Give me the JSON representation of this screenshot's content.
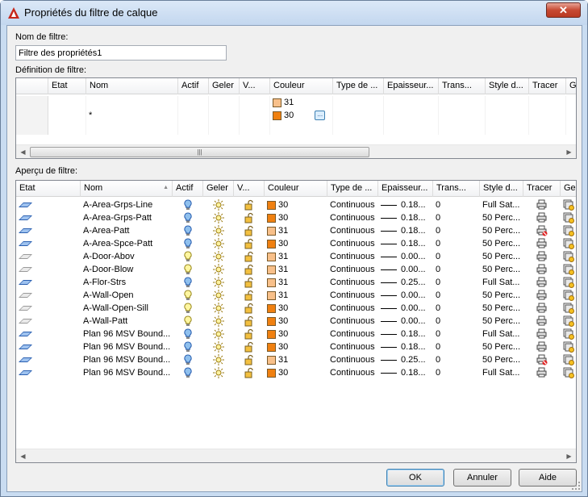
{
  "window": {
    "title": "Propriétés du filtre de calque",
    "close": "✕"
  },
  "filter_name": {
    "label": "Nom de filtre:",
    "value": "Filtre des propriétés1"
  },
  "definition": {
    "label": "Définition de filtre:",
    "columns": [
      "",
      "Etat",
      "Nom",
      "Actif",
      "Geler",
      "V...",
      "Couleur",
      "Type de ...",
      "Epaisseur...",
      "Trans...",
      "Style d...",
      "Tracer",
      "Ge..."
    ],
    "rows": [
      {
        "nom": "",
        "couleur": "31",
        "color_code": "31",
        "has_button": false
      },
      {
        "nom": "*",
        "couleur": "30",
        "color_code": "30",
        "has_button": true
      }
    ],
    "button_label": "..."
  },
  "preview": {
    "label": "Aperçu de filtre:",
    "columns": [
      "Etat",
      "Nom",
      "Actif",
      "Geler",
      "V...",
      "Couleur",
      "Type de ...",
      "Epaisseur...",
      "Trans...",
      "Style d...",
      "Tracer",
      "Ge..."
    ],
    "rows": [
      {
        "etat": "blue",
        "nom": "A-Area-Grps-Line",
        "actif": "blue",
        "couleur": "30",
        "type": "Continuous",
        "epaisseur": "0.18...",
        "trans": "0",
        "style": "Full Sat...",
        "tracer": "printer"
      },
      {
        "etat": "blue",
        "nom": "A-Area-Grps-Patt",
        "actif": "blue",
        "couleur": "30",
        "type": "Continuous",
        "epaisseur": "0.18...",
        "trans": "0",
        "style": "50 Perc...",
        "tracer": "printer"
      },
      {
        "etat": "blue",
        "nom": "A-Area-Patt",
        "actif": "blue",
        "couleur": "31",
        "type": "Continuous",
        "epaisseur": "0.18...",
        "trans": "0",
        "style": "50 Perc...",
        "tracer": "no-print"
      },
      {
        "etat": "blue",
        "nom": "A-Area-Spce-Patt",
        "actif": "blue",
        "couleur": "30",
        "type": "Continuous",
        "epaisseur": "0.18...",
        "trans": "0",
        "style": "50 Perc...",
        "tracer": "printer"
      },
      {
        "etat": "gray",
        "nom": "A-Door-Abov",
        "actif": "yellow",
        "couleur": "31",
        "type": "Continuous",
        "epaisseur": "0.00...",
        "trans": "0",
        "style": "50 Perc...",
        "tracer": "printer"
      },
      {
        "etat": "gray",
        "nom": "A-Door-Blow",
        "actif": "yellow",
        "couleur": "31",
        "type": "Continuous",
        "epaisseur": "0.00...",
        "trans": "0",
        "style": "50 Perc...",
        "tracer": "printer"
      },
      {
        "etat": "blue",
        "nom": "A-Flor-Strs",
        "actif": "blue",
        "couleur": "31",
        "type": "Continuous",
        "epaisseur": "0.25...",
        "trans": "0",
        "style": "Full Sat...",
        "tracer": "printer"
      },
      {
        "etat": "gray",
        "nom": "A-Wall-Open",
        "actif": "yellow",
        "couleur": "31",
        "type": "Continuous",
        "epaisseur": "0.00...",
        "trans": "0",
        "style": "50 Perc...",
        "tracer": "printer"
      },
      {
        "etat": "gray",
        "nom": "A-Wall-Open-Sill",
        "actif": "yellow",
        "couleur": "30",
        "type": "Continuous",
        "epaisseur": "0.00...",
        "trans": "0",
        "style": "50 Perc...",
        "tracer": "printer"
      },
      {
        "etat": "gray",
        "nom": "A-Wall-Patt",
        "actif": "yellow",
        "couleur": "30",
        "type": "Continuous",
        "epaisseur": "0.00...",
        "trans": "0",
        "style": "50 Perc...",
        "tracer": "printer"
      },
      {
        "etat": "blue",
        "nom": "Plan 96 MSV Bound...",
        "actif": "blue",
        "couleur": "30",
        "type": "Continuous",
        "epaisseur": "0.18...",
        "trans": "0",
        "style": "Full Sat...",
        "tracer": "printer"
      },
      {
        "etat": "blue",
        "nom": "Plan 96 MSV Bound...",
        "actif": "blue",
        "couleur": "30",
        "type": "Continuous",
        "epaisseur": "0.18...",
        "trans": "0",
        "style": "50 Perc...",
        "tracer": "printer"
      },
      {
        "etat": "blue",
        "nom": "Plan 96 MSV Bound...",
        "actif": "blue",
        "couleur": "31",
        "type": "Continuous",
        "epaisseur": "0.25...",
        "trans": "0",
        "style": "50 Perc...",
        "tracer": "no-print"
      },
      {
        "etat": "blue",
        "nom": "Plan 96 MSV Bound...",
        "actif": "blue",
        "couleur": "30",
        "type": "Continuous",
        "epaisseur": "0.18...",
        "trans": "0",
        "style": "Full Sat...",
        "tracer": "printer"
      }
    ]
  },
  "buttons": {
    "ok": "OK",
    "cancel": "Annuler",
    "help": "Aide"
  },
  "icons": {
    "thumb_grip": "|||"
  },
  "colors": {
    "color_30": "#f08010",
    "color_31": "#f8c08a",
    "title_accent": "#c7271a"
  }
}
